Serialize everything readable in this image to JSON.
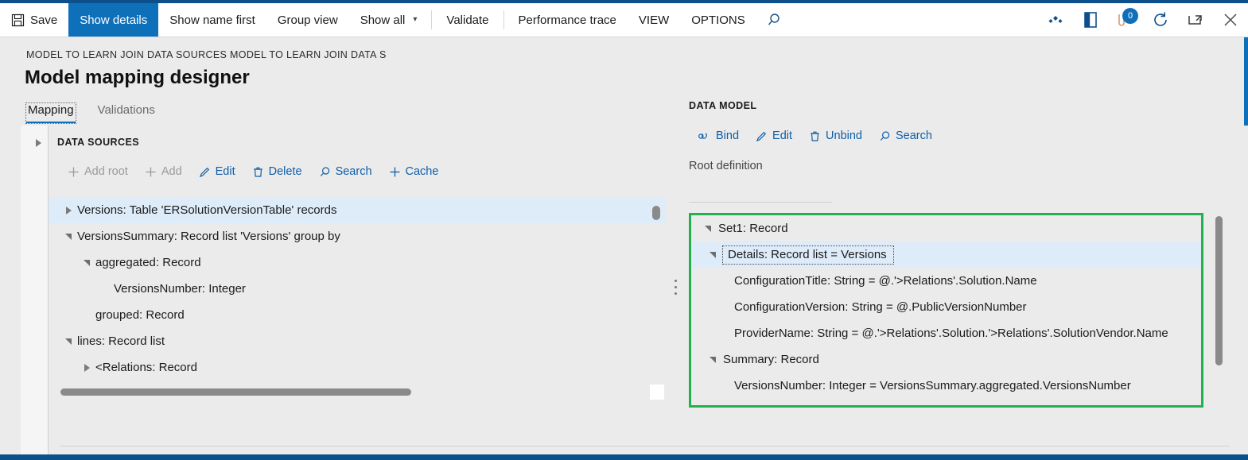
{
  "toolbar": {
    "items": [
      {
        "label": "Save",
        "icon": "save-icon",
        "state": "normal"
      },
      {
        "label": "Show details",
        "icon": "",
        "state": "selected"
      },
      {
        "label": "Show name first",
        "icon": "",
        "state": "normal"
      },
      {
        "label": "Group view",
        "icon": "",
        "state": "normal"
      },
      {
        "label": "Show all",
        "icon": "chevron-down-icon",
        "state": "normal"
      },
      {
        "label": "Validate",
        "icon": "",
        "state": "normal"
      },
      {
        "label": "Performance trace",
        "icon": "",
        "state": "normal"
      },
      {
        "label": "VIEW",
        "icon": "",
        "state": "normal"
      },
      {
        "label": "OPTIONS",
        "icon": "",
        "state": "normal"
      }
    ],
    "search_icon": "search-icon",
    "right_icons": [
      {
        "name": "diamonds-icon"
      },
      {
        "name": "book-open-icon"
      },
      {
        "name": "attachment-icon",
        "badge": "0"
      },
      {
        "name": "refresh-icon"
      },
      {
        "name": "popout-icon"
      },
      {
        "name": "close-icon"
      }
    ]
  },
  "header": {
    "breadcrumb": "MODEL TO LEARN JOIN DATA SOURCES MODEL TO LEARN JOIN DATA S",
    "title": "Model mapping designer"
  },
  "tabs": [
    {
      "label": "Mapping",
      "active": true
    },
    {
      "label": "Validations",
      "active": false
    }
  ],
  "data_sources": {
    "section_title": "DATA SOURCES",
    "expander": "chevron-right-icon",
    "actions": [
      {
        "label": "Add root",
        "icon": "plus-icon",
        "disabled": true
      },
      {
        "label": "Add",
        "icon": "plus-icon",
        "disabled": true
      },
      {
        "label": "Edit",
        "icon": "pencil-icon",
        "disabled": false
      },
      {
        "label": "Delete",
        "icon": "trash-icon",
        "disabled": false
      },
      {
        "label": "Search",
        "icon": "search-icon",
        "disabled": false
      },
      {
        "label": "Cache",
        "icon": "plus-icon",
        "disabled": false
      }
    ],
    "tree": [
      {
        "label": "Versions: Table 'ERSolutionVersionTable' records",
        "indent": 0,
        "expander": "collapsed",
        "selected": true
      },
      {
        "label": "VersionsSummary: Record list 'Versions' group by",
        "indent": 0,
        "expander": "expanded",
        "selected": false
      },
      {
        "label": "aggregated: Record",
        "indent": 1,
        "expander": "expanded",
        "selected": false
      },
      {
        "label": "VersionsNumber: Integer",
        "indent": 2,
        "expander": "none",
        "selected": false
      },
      {
        "label": "grouped: Record",
        "indent": 1,
        "expander": "none",
        "selected": false
      },
      {
        "label": "lines: Record list",
        "indent": 0,
        "expander": "expanded",
        "selected": false
      },
      {
        "label": "<Relations: Record",
        "indent": 1,
        "expander": "collapsed",
        "selected": false
      }
    ]
  },
  "data_model": {
    "section_title": "DATA MODEL",
    "actions": [
      {
        "label": "Bind",
        "icon": "link-icon",
        "disabled": false
      },
      {
        "label": "Edit",
        "icon": "pencil-icon",
        "disabled": false
      },
      {
        "label": "Unbind",
        "icon": "trash-icon",
        "disabled": false
      },
      {
        "label": "Search",
        "icon": "search-icon",
        "disabled": false
      }
    ],
    "root_definition": "Root definition",
    "highlight_color": "#22b14c",
    "tree": [
      {
        "label": "Set1: Record",
        "indent": 0,
        "expander": "expanded",
        "selected": false,
        "focused": false
      },
      {
        "label": "Details: Record list = Versions",
        "indent": 1,
        "expander": "expanded",
        "selected": true,
        "focused": true
      },
      {
        "label": "ConfigurationTitle: String = @.'>Relations'.Solution.Name",
        "indent": 2,
        "expander": "none",
        "selected": false,
        "focused": false
      },
      {
        "label": "ConfigurationVersion: String = @.PublicVersionNumber",
        "indent": 2,
        "expander": "none",
        "selected": false,
        "focused": false
      },
      {
        "label": "ProviderName: String = @.'>Relations'.Solution.'>Relations'.SolutionVendor.Name",
        "indent": 2,
        "expander": "none",
        "selected": false,
        "focused": false
      },
      {
        "label": "Summary: Record",
        "indent": 1,
        "expander": "expanded",
        "selected": false,
        "focused": false
      },
      {
        "label": "VersionsNumber: Integer = VersionsSummary.aggregated.VersionsNumber",
        "indent": 2,
        "expander": "none",
        "selected": false,
        "focused": false
      }
    ]
  },
  "colors": {
    "accent": "#0f70ba",
    "chrome_dark": "#0d4f8b",
    "selection": "#deecf9",
    "surface": "#ebebeb",
    "link": "#0f5ea8",
    "highlight": "#22b14c"
  }
}
